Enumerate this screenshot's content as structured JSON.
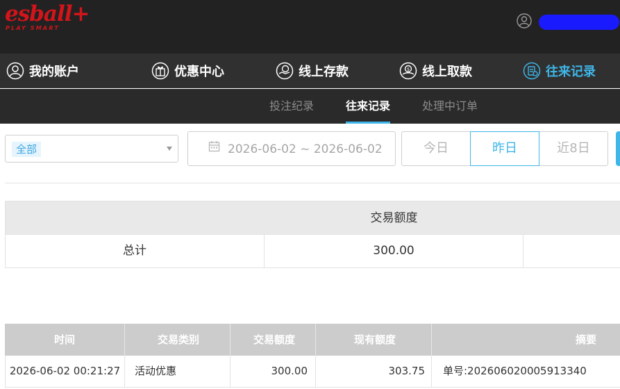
{
  "brand": {
    "logo_text": "esball+",
    "logo_tagline": "PLAY SMART",
    "color": "#d3141b"
  },
  "header": {
    "user_icon": "user-circle-icon"
  },
  "accent_color": "#3fb6e7",
  "main_nav": [
    {
      "label": "我的账户",
      "icon": "user-icon",
      "active": false
    },
    {
      "label": "优惠中心",
      "icon": "gift-icon",
      "active": false
    },
    {
      "label": "线上存款",
      "icon": "deposit-icon",
      "active": false
    },
    {
      "label": "线上取款",
      "icon": "withdraw-icon",
      "active": false
    },
    {
      "label": "往来记录",
      "icon": "records-icon",
      "active": true
    }
  ],
  "sub_nav": [
    {
      "label": "投注纪录",
      "active": false
    },
    {
      "label": "往来记录",
      "active": true
    },
    {
      "label": "处理中订单",
      "active": false
    }
  ],
  "filters": {
    "type_selected": "全部",
    "date_range": "2026-06-02 ~ 2026-06-02",
    "quick": [
      {
        "label": "今日",
        "active": false
      },
      {
        "label": "昨日",
        "active": true
      },
      {
        "label": "近8日",
        "active": false
      }
    ]
  },
  "summary": {
    "header": "交易额度",
    "row_label": "总计",
    "row_value": "300.00"
  },
  "records": {
    "columns": [
      "时间",
      "交易类别",
      "交易额度",
      "现有额度",
      "摘要"
    ],
    "rows": [
      [
        "2026-06-02 00:21:27",
        "活动优惠",
        "300.00",
        "303.75",
        "单号:202606020005913340"
      ]
    ]
  }
}
